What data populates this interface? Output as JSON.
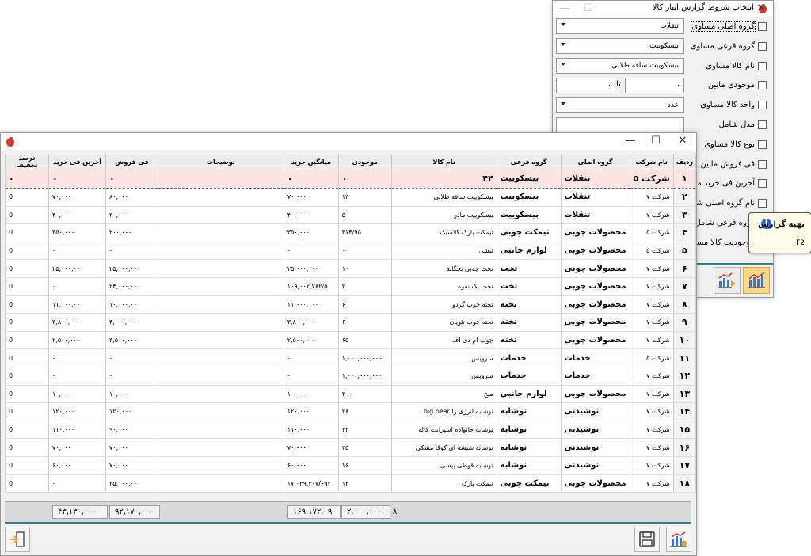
{
  "filter_window": {
    "title": "انتخاب شروط گزارش انبار کالا",
    "checkboxes": [
      "گروه اصلی مساوی",
      "گروه فرعی مساوی",
      "نام کالا مساوی",
      "موجودی مابین",
      "واحد کالا مساوی",
      "مدل شامل",
      "نوع کالا مساوی",
      "فی فروش مابین",
      "آخرین فی خرید مابین",
      "نام گروه اصلی شامل",
      "گروه فرعی شامل",
      "موجودیت کالا مساوی"
    ],
    "main_group_value": "تنقلات",
    "sub_group_value": "بیسکوییت",
    "product_name_value": "بیسکوییت ساقه طلایی",
    "stock_from_value": "۰",
    "stock_to_label": "تا",
    "stock_to_value": "۰",
    "unit_value": "عدد",
    "model_value": ""
  },
  "tooltip": {
    "title": "تهیه گزارش",
    "shortcut": "F2",
    "icon": "info-icon"
  },
  "report_window": {
    "columns": [
      "ردیف",
      "نام شرکت",
      "گروه اصلی",
      "گروه فرعی",
      "نام کالا",
      "موجودی",
      "میانگین خرید",
      "توضیحات",
      "فی فروش",
      "آخرین فی خرید",
      "درصد تخفیف"
    ],
    "rows": [
      [
        "۱",
        "شرکت ۵",
        "تنقلات",
        "بیسکوییت",
        "۴۴",
        "۰",
        "۰",
        "",
        "۰",
        "۰",
        "۰"
      ],
      [
        "۲",
        "شرکت ۷",
        "تنقلات",
        "بیسکوییت",
        "بیسکوییت ساقه طلایی",
        "۱۳",
        "۷۰,۰۰۰",
        "",
        "۸۰,۰۰۰",
        "۷۰,۰۰۰",
        "0"
      ],
      [
        "۳",
        "شرکت ۷",
        "تنقلات",
        "بیسکوییت",
        "بیسکوییت مادر",
        "۵",
        "۴۰,۰۰۰",
        "",
        "۳۰,۰۰۰",
        "۴۰,۰۰۰",
        "0"
      ],
      [
        "۴",
        "شرکت ۵",
        "محصولات چوبی",
        "نیمکت چوبی",
        "نیمکت پارک کلاسیک",
        "۳۱۴/۹۵",
        "۳۵۰,۰۰۰",
        "",
        "۲۰۰,۰۰۰",
        "۳۵۰,۰۰۰",
        "0"
      ],
      [
        "۵",
        "شرکت ۵",
        "محصولات چوبی",
        "لوازم جانبی",
        "تیشی",
        "۰",
        "۰",
        "",
        "۰",
        "۰",
        "0"
      ],
      [
        "۶",
        "شرکت ۷",
        "محصولات چوبی",
        "تخت",
        "تخت چوبی بچگانه",
        "۱۰",
        "۲۵,۰۰۰,۰۰۰",
        "",
        "۲۵,۰۰۰,۰۰۰",
        "۲۵,۰۰۰,۰۰۰",
        "0"
      ],
      [
        "۷",
        "شرکت ۷",
        "محصولات چوبی",
        "تخت",
        "تخت یک نفره",
        "۲",
        "۱۰۹,۰۰۲,۷۸۲/۵",
        "",
        "۲۴,۰۰۰,۰۰۰",
        "۰",
        "0"
      ],
      [
        "۸",
        "شرکت ۷",
        "محصولات چوبی",
        "تخته",
        "تخته چوب گردو",
        "۶",
        "۱۱,۰۰۰,۰۰۰",
        "",
        "۱۰,۰۰۰,۰۰۰",
        "۱۱,۰۰۰,۰۰۰",
        "0"
      ],
      [
        "۹",
        "شرکت ۷",
        "محصولات چوبی",
        "تخته",
        "تخته چوب نئوپان",
        "۶",
        "۳,۸۰۰,۰۰۰",
        "",
        "۴,۰۰۰,۰۰۰",
        "۳,۸۰۰,۰۰۰",
        "0"
      ],
      [
        "۱۰",
        "شرکت ۷",
        "محصولات چوبی",
        "تخته",
        "چوب ام دی اف",
        "۶۵",
        "۲,۵۰۰,۰۰۰",
        "",
        "۳,۵۰۰,۰۰۰",
        "۲,۵۰۰,۰۰۰",
        "0"
      ],
      [
        "۱۱",
        "شرکت ۵",
        "خدمات",
        "خدمات",
        "سرویس",
        "۱,۰۰۰,۰۰۰,۰۰۰",
        "۰",
        "",
        "۰",
        "۰",
        "0"
      ],
      [
        "۱۲",
        "شرکت ۷",
        "خدمات",
        "خدمات",
        "سرویس",
        "۱,۰۰۰,۰۰۰,۰۰۰",
        "۰",
        "",
        "۰",
        "۰",
        "0"
      ],
      [
        "۱۳",
        "شرکت ۷",
        "محصولات چوبی",
        "لوازم جانبی",
        "میخ",
        "۳۰۰",
        "۱۰,۰۰۰",
        "",
        "۱۰,۰۰۰",
        "۱۰,۰۰۰",
        "0"
      ],
      [
        "۱۴",
        "شرکت ۷",
        "نوشیدنی",
        "نوشابه",
        "نوشابه انرژی زا big bear",
        "۲۸",
        "۱۲۰,۰۰۰",
        "",
        "۱۲۰,۰۰۰",
        "۱۲۰,۰۰۰",
        "0"
      ],
      [
        "۱۵",
        "شرکت ۷",
        "نوشیدنی",
        "نوشابه",
        "نوشابه خانواده اسپرایت کاله",
        "۲۲",
        "۱۱۰,۰۰۰",
        "",
        "۹۰,۰۰۰",
        "۱۱۰,۰۰۰",
        "0"
      ],
      [
        "۱۶",
        "شرکت ۷",
        "نوشیدنی",
        "نوشابه",
        "نوشابه شیشه ای کوکا مشکی",
        "۳۵",
        "۷۰,۰۰۰",
        "",
        "۷۰,۰۰۰",
        "۷۰,۰۰۰",
        "0"
      ],
      [
        "۱۷",
        "شرکت ۷",
        "نوشیدنی",
        "نوشابه",
        "نوشابه قوطی پپسی",
        "۱۶",
        "۶۰,۰۰۰",
        "",
        "۷۰,۰۰۰",
        "۶۰,۰۰۰",
        "0"
      ],
      [
        "۱۸",
        "شرکت ۷",
        "محصولات چوبی",
        "نیمکت چوبی",
        "نیمکت پارک",
        "۱۳",
        "۱۷,۰۳۹,۳۰۷/۶۹۲",
        "",
        "۲۵,۰۰۰,۰۰۰",
        "۰",
        "0"
      ]
    ],
    "totals": {
      "stock": "۲,۰۰۰,۰۰۰,۰۰۸",
      "avg_purchase": "۱۶۹,۱۷۲,۰۹۰",
      "sale_price": "۹۲,۱۷۰,۰۰۰",
      "last_purchase": "۴۳,۱۳۰,۰۰۰"
    }
  },
  "colors": {
    "selected_row": "#fde4e4",
    "accent_line": "#2c7d9a",
    "tooltip_bg": "#fffbe8",
    "hot_button": "#ffd88a"
  }
}
